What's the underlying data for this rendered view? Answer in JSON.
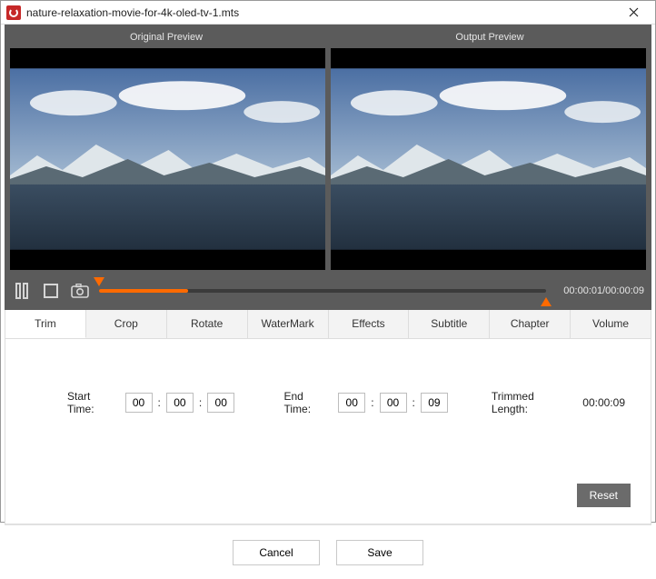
{
  "window": {
    "title": "nature-relaxation-movie-for-4k-oled-tv-1.mts"
  },
  "preview": {
    "original_label": "Original Preview",
    "output_label": "Output Preview"
  },
  "playback": {
    "time_readout": "00:00:01/00:00:09",
    "progress_pct": 20
  },
  "tabs": {
    "items": [
      {
        "label": "Trim",
        "active": true
      },
      {
        "label": "Crop",
        "active": false
      },
      {
        "label": "Rotate",
        "active": false
      },
      {
        "label": "WaterMark",
        "active": false
      },
      {
        "label": "Effects",
        "active": false
      },
      {
        "label": "Subtitle",
        "active": false
      },
      {
        "label": "Chapter",
        "active": false
      },
      {
        "label": "Volume",
        "active": false
      }
    ]
  },
  "trim": {
    "start_label": "Start Time:",
    "end_label": "End Time:",
    "trimmed_label": "Trimmed Length:",
    "start": {
      "h": "00",
      "m": "00",
      "s": "00"
    },
    "end": {
      "h": "00",
      "m": "00",
      "s": "09"
    },
    "trimmed_value": "00:00:09",
    "reset_label": "Reset"
  },
  "footer": {
    "cancel_label": "Cancel",
    "save_label": "Save"
  }
}
